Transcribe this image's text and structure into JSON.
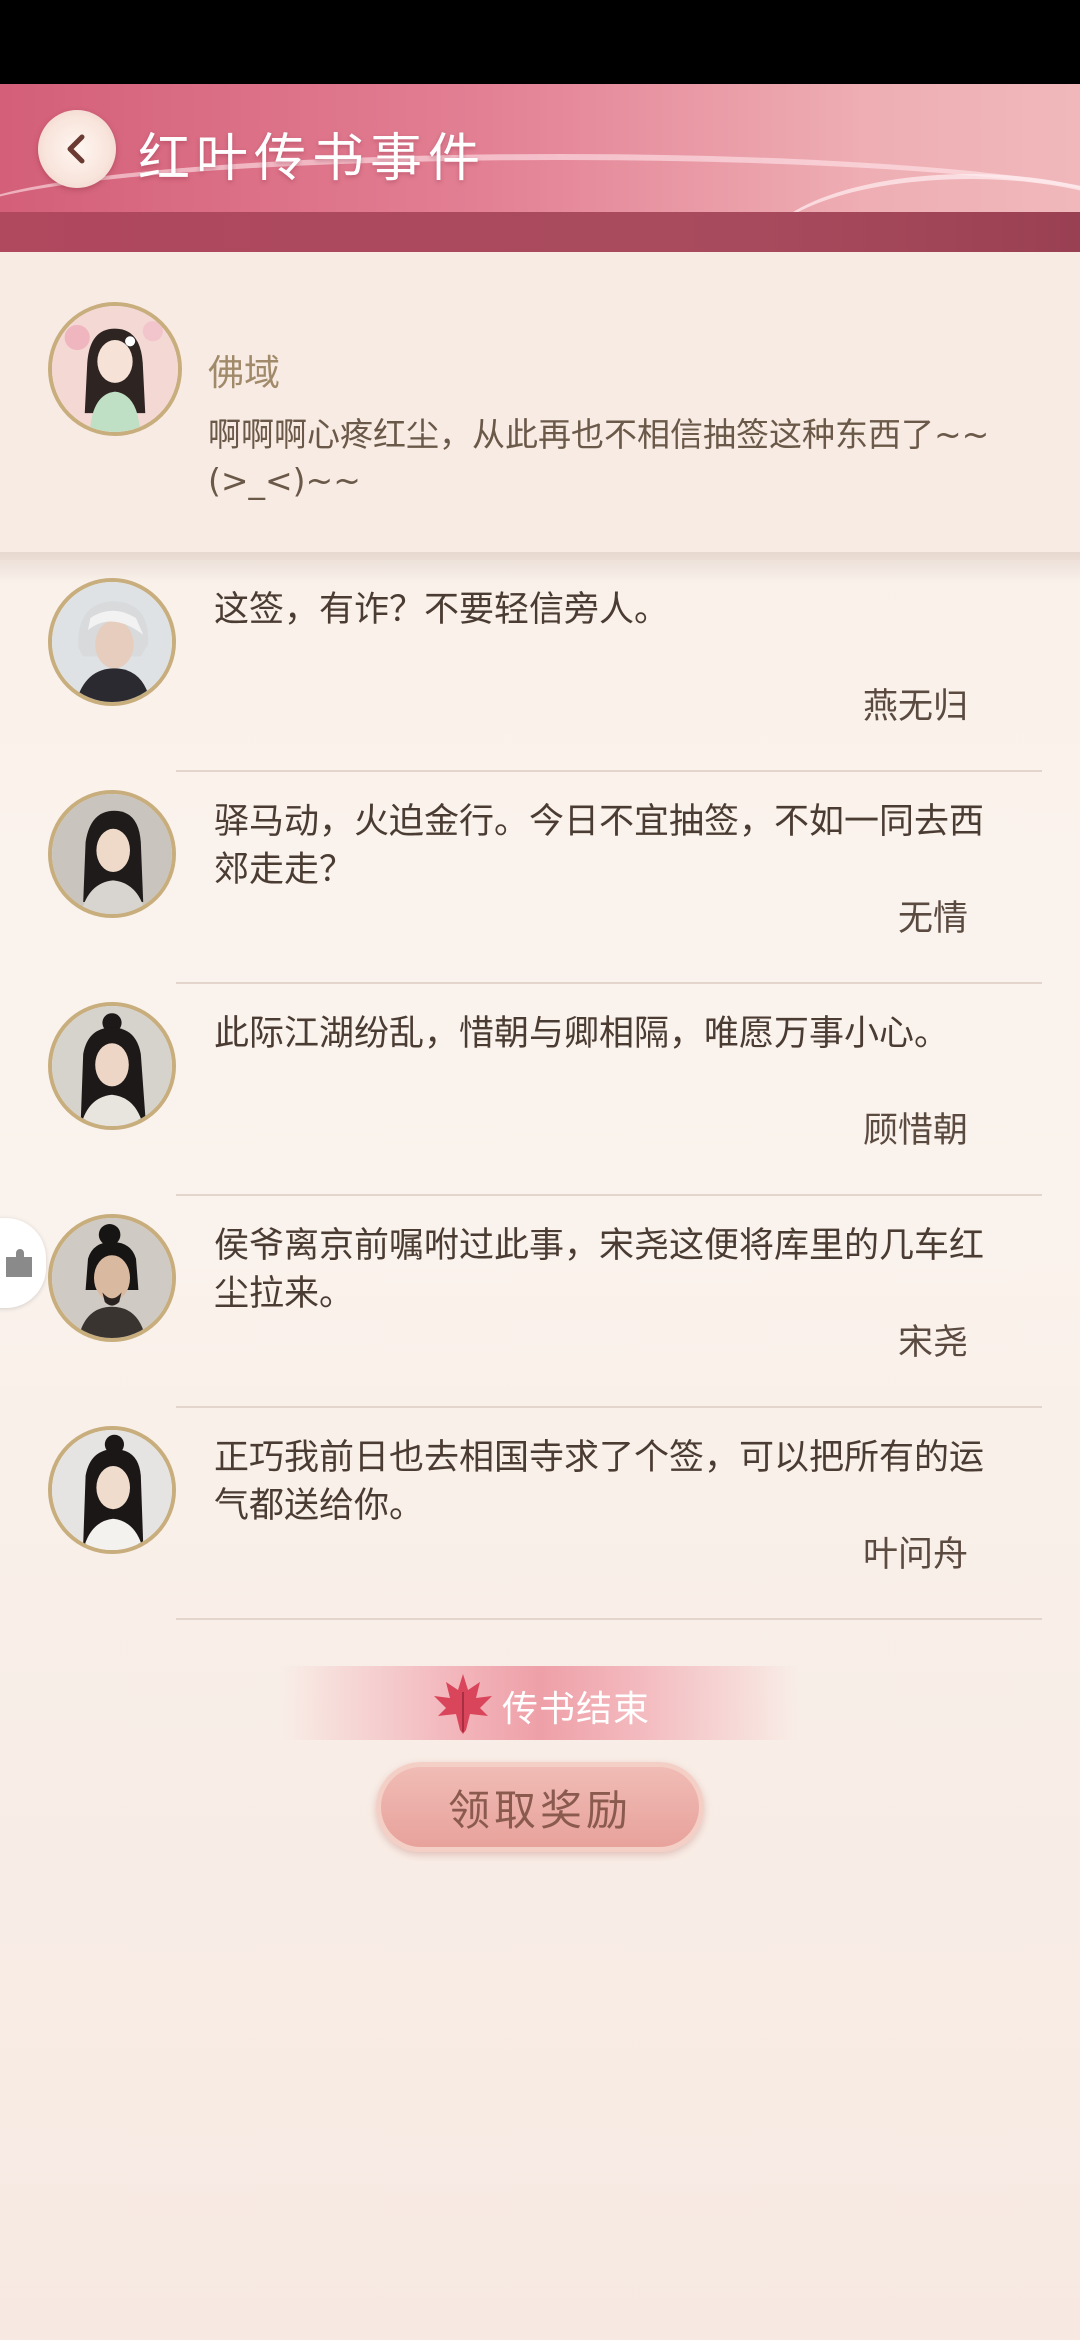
{
  "header": {
    "title": "红叶传书事件",
    "back_icon": "chevron-left-icon",
    "accent": "#d35f78"
  },
  "post": {
    "name": "佛域",
    "text": "啊啊啊心疼红尘，从此再也不相信抽签这种东西了~~(>_<)~~"
  },
  "replies": [
    {
      "text": "这签，有诈？不要轻信旁人。",
      "author": "燕无归"
    },
    {
      "text": "驿马动，火迫金行。今日不宜抽签，不如一同去西郊走走？",
      "author": "无情"
    },
    {
      "text": "此际江湖纷乱，惜朝与卿相隔，唯愿万事小心。",
      "author": "顾惜朝"
    },
    {
      "text": "侯爷离京前嘱咐过此事，宋尧这便将库里的几车红尘拉来。",
      "author": "宋尧"
    },
    {
      "text": "正巧我前日也去相国寺求了个签，可以把所有的运气都送给你。",
      "author": "叶问舟"
    }
  ],
  "footer": {
    "end_label": "传书结束",
    "reward_button": "领取奖励"
  }
}
